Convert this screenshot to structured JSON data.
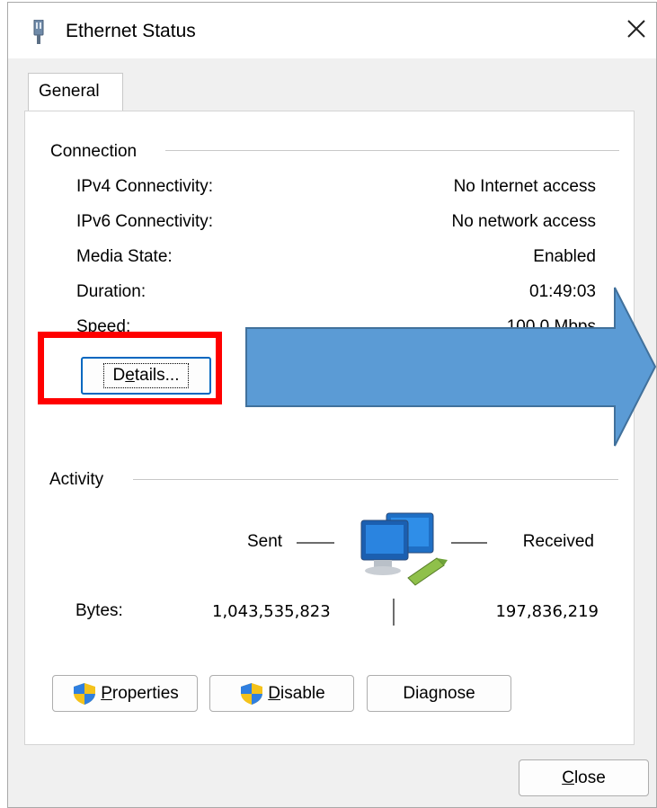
{
  "window": {
    "title": "Ethernet Status",
    "tab": "General"
  },
  "connection": {
    "group_label": "Connection",
    "rows": [
      {
        "label": "IPv4 Connectivity:",
        "value": "No Internet access"
      },
      {
        "label": "IPv6 Connectivity:",
        "value": "No network access"
      },
      {
        "label": "Media State:",
        "value": "Enabled"
      },
      {
        "label": "Duration:",
        "value": "01:49:03"
      },
      {
        "label": "Speed:",
        "value": "100.0 Mbps"
      }
    ],
    "details_button": {
      "pre": "D",
      "mnemonic": "e",
      "post": "tails..."
    }
  },
  "activity": {
    "group_label": "Activity",
    "sent_label": "Sent",
    "received_label": "Received",
    "bytes_label": "Bytes:",
    "bytes_sent": "1,043,535,823",
    "bytes_received": "197,836,219"
  },
  "buttons": {
    "properties": {
      "mnemonic": "P",
      "rest": "roperties"
    },
    "disable": {
      "mnemonic": "D",
      "rest": "isable"
    },
    "diagnose": {
      "pre": "Dia",
      "mnemonic": "g",
      "post": "nose"
    },
    "close": {
      "mnemonic": "C",
      "rest": "lose"
    }
  },
  "annotation": {
    "highlight_color": "#ff0000",
    "arrow_color": "#5b9bd5",
    "arrow_border": "#41719c"
  },
  "icons": [
    "network-adapter-icon",
    "close-icon",
    "network-computers-icon",
    "uac-shield-icon"
  ]
}
